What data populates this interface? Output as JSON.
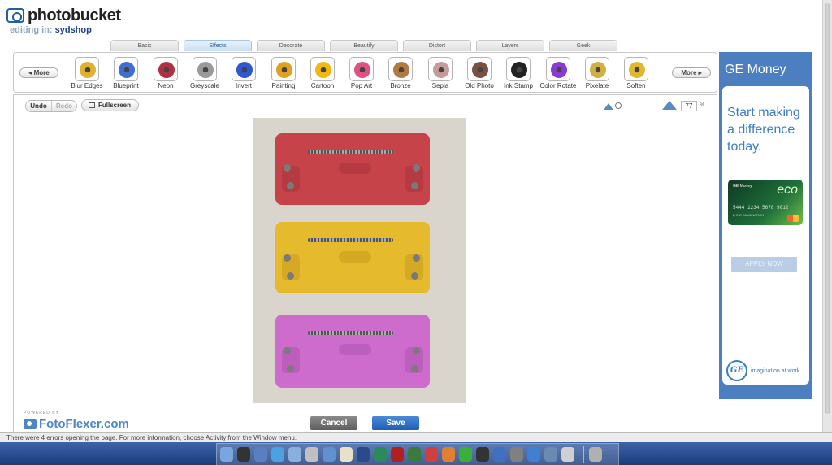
{
  "header": {
    "logo_text": "photobucket",
    "editing_label": "editing in:",
    "editing_user": "sydshop"
  },
  "tabs": [
    {
      "label": "Basic",
      "active": false
    },
    {
      "label": "Effects",
      "active": true
    },
    {
      "label": "Decorate",
      "active": false
    },
    {
      "label": "Beautify",
      "active": false
    },
    {
      "label": "Distort",
      "active": false
    },
    {
      "label": "Layers",
      "active": false
    },
    {
      "label": "Geek",
      "active": false
    }
  ],
  "toolbar": {
    "more_left": "More",
    "more_right": "More",
    "effects": [
      {
        "label": "Blur Edges",
        "icon": "blur-edges-icon",
        "color": "#e0b030"
      },
      {
        "label": "Blueprint",
        "icon": "blueprint-icon",
        "color": "#3d6fd0"
      },
      {
        "label": "Neon",
        "icon": "neon-icon",
        "color": "#b03040"
      },
      {
        "label": "Greyscale",
        "icon": "greyscale-icon",
        "color": "#9a9a9a"
      },
      {
        "label": "Invert",
        "icon": "invert-icon",
        "color": "#2e57d6"
      },
      {
        "label": "Painting",
        "icon": "painting-icon",
        "color": "#e0a020"
      },
      {
        "label": "Cartoon",
        "icon": "cartoon-icon",
        "color": "#f0b810"
      },
      {
        "label": "Pop Art",
        "icon": "pop-art-icon",
        "color": "#e05080"
      },
      {
        "label": "Bronze",
        "icon": "bronze-icon",
        "color": "#b07a40"
      },
      {
        "label": "Sepia",
        "icon": "sepia-icon",
        "color": "#c79a9a"
      },
      {
        "label": "Old Photo",
        "icon": "old-photo-icon",
        "color": "#7a5040"
      },
      {
        "label": "Ink Stamp",
        "icon": "ink-stamp-icon",
        "color": "#222222"
      },
      {
        "label": "Color Rotate",
        "icon": "color-rotate-icon",
        "color": "#8a3ad0"
      },
      {
        "label": "Pixelate",
        "icon": "pixelate-icon",
        "color": "#d0b040"
      },
      {
        "label": "Soften",
        "icon": "soften-icon",
        "color": "#e0b830"
      }
    ]
  },
  "editor": {
    "undo": "Undo",
    "redo": "Redo",
    "fullscreen": "Fullscreen",
    "zoom_value": "77",
    "zoom_unit": "%",
    "zoom_fraction": 0.0,
    "powered_by": "POWERED BY",
    "brand": "FotoFlexer.com",
    "cancel": "Cancel",
    "save": "Save"
  },
  "ad": {
    "brand": "GE Money",
    "headline": "Start making a difference today.",
    "card_label": "GE Money",
    "card_eco": "eco",
    "card_number": "5444 1234 5678 9012",
    "card_name": "E.C.O IMAGINATION",
    "apply": "APPLY NOW",
    "ge_logo": "GE",
    "tagline": "imagination at work"
  },
  "statusbar": {
    "text": "There were 4 errors opening the page. For more information, choose Activity from the Window menu."
  },
  "dock": {
    "icons": [
      "finder-icon",
      "dashboard-icon",
      "mail-icon",
      "safari-icon",
      "itunes-icon",
      "system-icon",
      "preview-icon",
      "textedit-icon",
      "photoshop-icon",
      "dreamweaver-icon",
      "flash-icon",
      "notes-icon",
      "address-book-icon",
      "chat-icon",
      "calculator-icon",
      "terminal-icon",
      "network-icon",
      "airport-icon",
      "network2-icon",
      "preferences-icon",
      "photos-icon",
      "trash-icon"
    ]
  }
}
